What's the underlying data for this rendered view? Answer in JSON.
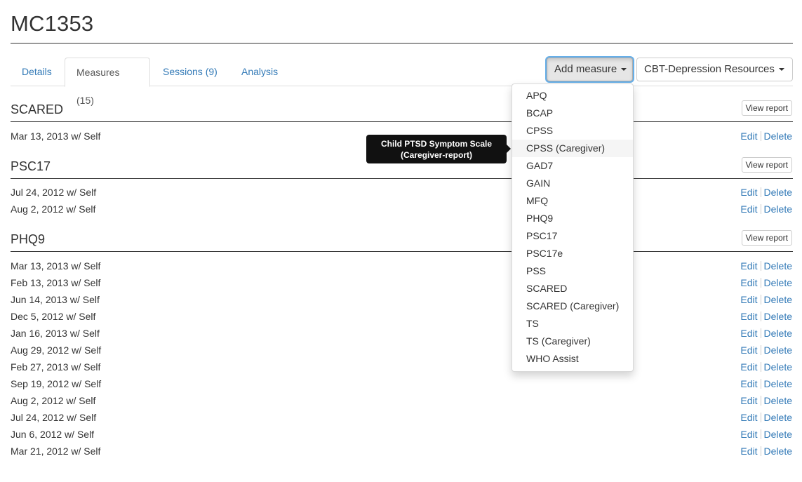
{
  "page": {
    "title": "MC1353"
  },
  "tabs": [
    {
      "label": "Details"
    },
    {
      "label": "Measures (15)"
    },
    {
      "label": "Sessions (9)"
    },
    {
      "label": "Analysis"
    }
  ],
  "toolbar": {
    "add_measure_label": "Add measure",
    "resources_label": "CBT-Depression Resources"
  },
  "sections": [
    {
      "title": "SCARED",
      "view_report_label": "View report",
      "rows": [
        {
          "date": "Mar 13, 2013 w/ Self"
        }
      ]
    },
    {
      "title": "PSC17",
      "view_report_label": "View report",
      "rows": [
        {
          "date": "Jul 24, 2012 w/ Self"
        },
        {
          "date": "Aug 2, 2012 w/ Self"
        }
      ]
    },
    {
      "title": "PHQ9",
      "view_report_label": "View report",
      "rows": [
        {
          "date": "Mar 13, 2013 w/ Self"
        },
        {
          "date": "Feb 13, 2013 w/ Self"
        },
        {
          "date": "Jun 14, 2013 w/ Self"
        },
        {
          "date": "Dec 5, 2012 w/ Self"
        },
        {
          "date": "Jan 16, 2013 w/ Self"
        },
        {
          "date": "Aug 29, 2012 w/ Self"
        },
        {
          "date": "Feb 27, 2013 w/ Self"
        },
        {
          "date": "Sep 19, 2012 w/ Self"
        },
        {
          "date": "Aug 2, 2012 w/ Self"
        },
        {
          "date": "Jul 24, 2012 w/ Self"
        },
        {
          "date": "Jun 6, 2012 w/ Self"
        },
        {
          "date": "Mar 21, 2012 w/ Self"
        }
      ]
    }
  ],
  "row_actions": {
    "edit_label": "Edit",
    "delete_label": "Delete"
  },
  "dropdown": {
    "items": [
      "APQ",
      "BCAP",
      "CPSS",
      "CPSS (Caregiver)",
      "GAD7",
      "GAIN",
      "MFQ",
      "PHQ9",
      "PSC17",
      "PSC17e",
      "PSS",
      "SCARED",
      "SCARED (Caregiver)",
      "TS",
      "TS (Caregiver)",
      "WHO Assist"
    ],
    "hovered_item": "CPSS (Caregiver)"
  },
  "tooltip": {
    "line1": "Child PTSD Symptom Scale",
    "line2": "(Caregiver-report)"
  },
  "colors": {
    "link": "#337ab7",
    "text": "#333333",
    "tooltip_bg": "#111111",
    "focus_ring": "#66afe9"
  },
  "icons": {
    "dropdown_caret": "caret-down-icon"
  }
}
